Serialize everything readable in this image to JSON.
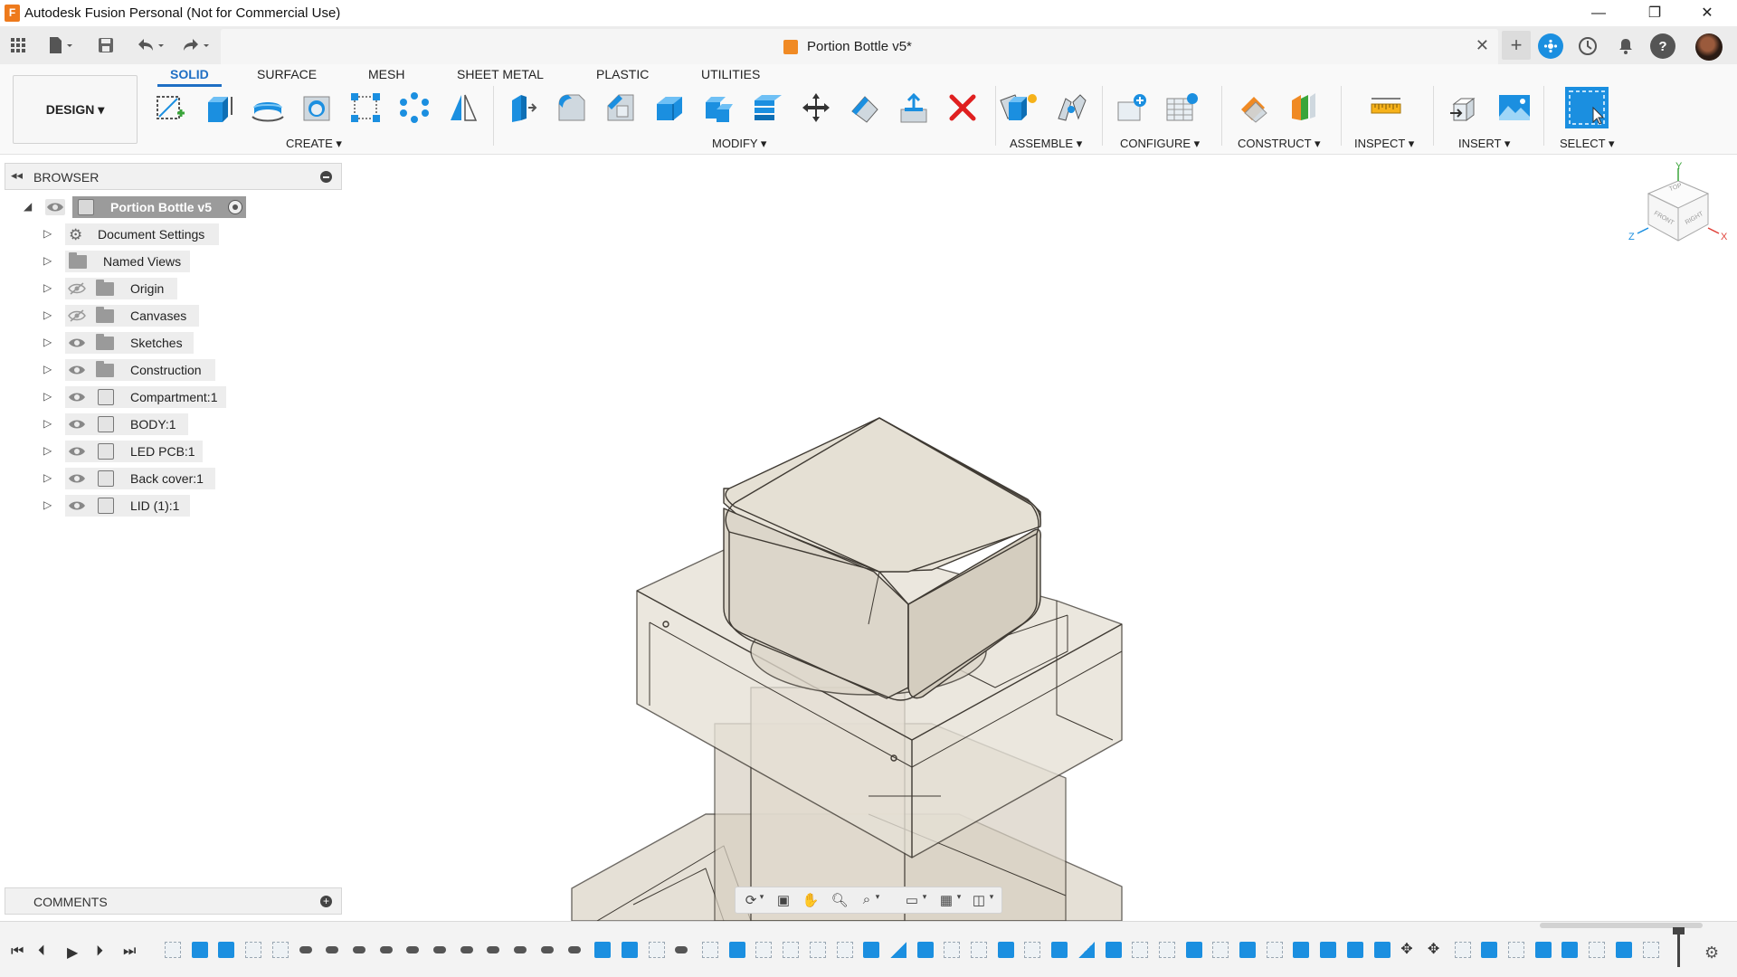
{
  "window": {
    "title": "Autodesk Fusion Personal (Not for Commercial Use)",
    "app_icon_letter": "F",
    "minimize": "—",
    "restore": "❐",
    "close": "✕"
  },
  "document_tab": {
    "title": "Portion Bottle v5*",
    "close": "✕"
  },
  "workspace": {
    "label": "DESIGN ▾"
  },
  "ribbon": {
    "tabs": [
      "SOLID",
      "SURFACE",
      "MESH",
      "SHEET METAL",
      "PLASTIC",
      "UTILITIES"
    ],
    "active_tab": "SOLID",
    "groups": {
      "create": "CREATE ▾",
      "modify": "MODIFY ▾",
      "assemble": "ASSEMBLE ▾",
      "configure": "CONFIGURE ▾",
      "construct": "CONSTRUCT ▾",
      "inspect": "INSPECT ▾",
      "insert": "INSERT ▾",
      "select": "SELECT ▾"
    }
  },
  "browser": {
    "title": "BROWSER",
    "root": "Portion Bottle v5",
    "items": [
      {
        "label": "Document Settings",
        "icon": "gear-icon"
      },
      {
        "label": "Named Views",
        "icon": "folder-icon"
      },
      {
        "label": "Origin",
        "icon": "folder-icon",
        "hidden": true
      },
      {
        "label": "Canvases",
        "icon": "folder-icon",
        "hidden": true
      },
      {
        "label": "Sketches",
        "icon": "folder-icon"
      },
      {
        "label": "Construction",
        "icon": "folder-icon"
      },
      {
        "label": "Compartment:1",
        "icon": "component-icon"
      },
      {
        "label": "BODY:1",
        "icon": "component-icon"
      },
      {
        "label": "LED PCB:1",
        "icon": "component-icon"
      },
      {
        "label": "Back cover:1",
        "icon": "component-icon"
      },
      {
        "label": "LID (1):1",
        "icon": "component-icon"
      }
    ]
  },
  "comments": {
    "title": "COMMENTS"
  },
  "viewcube": {
    "top": "TOP",
    "front": "FRONT",
    "right": "RIGHT",
    "axis_x": "X",
    "axis_y": "Y",
    "axis_z": "Z"
  },
  "colors": {
    "accent": "#1f6fc4",
    "model_fill": "#e6e1d6",
    "model_edge": "#3f3a33",
    "app_orange": "#ee7a1c",
    "select_blue": "#1b8fe0"
  }
}
